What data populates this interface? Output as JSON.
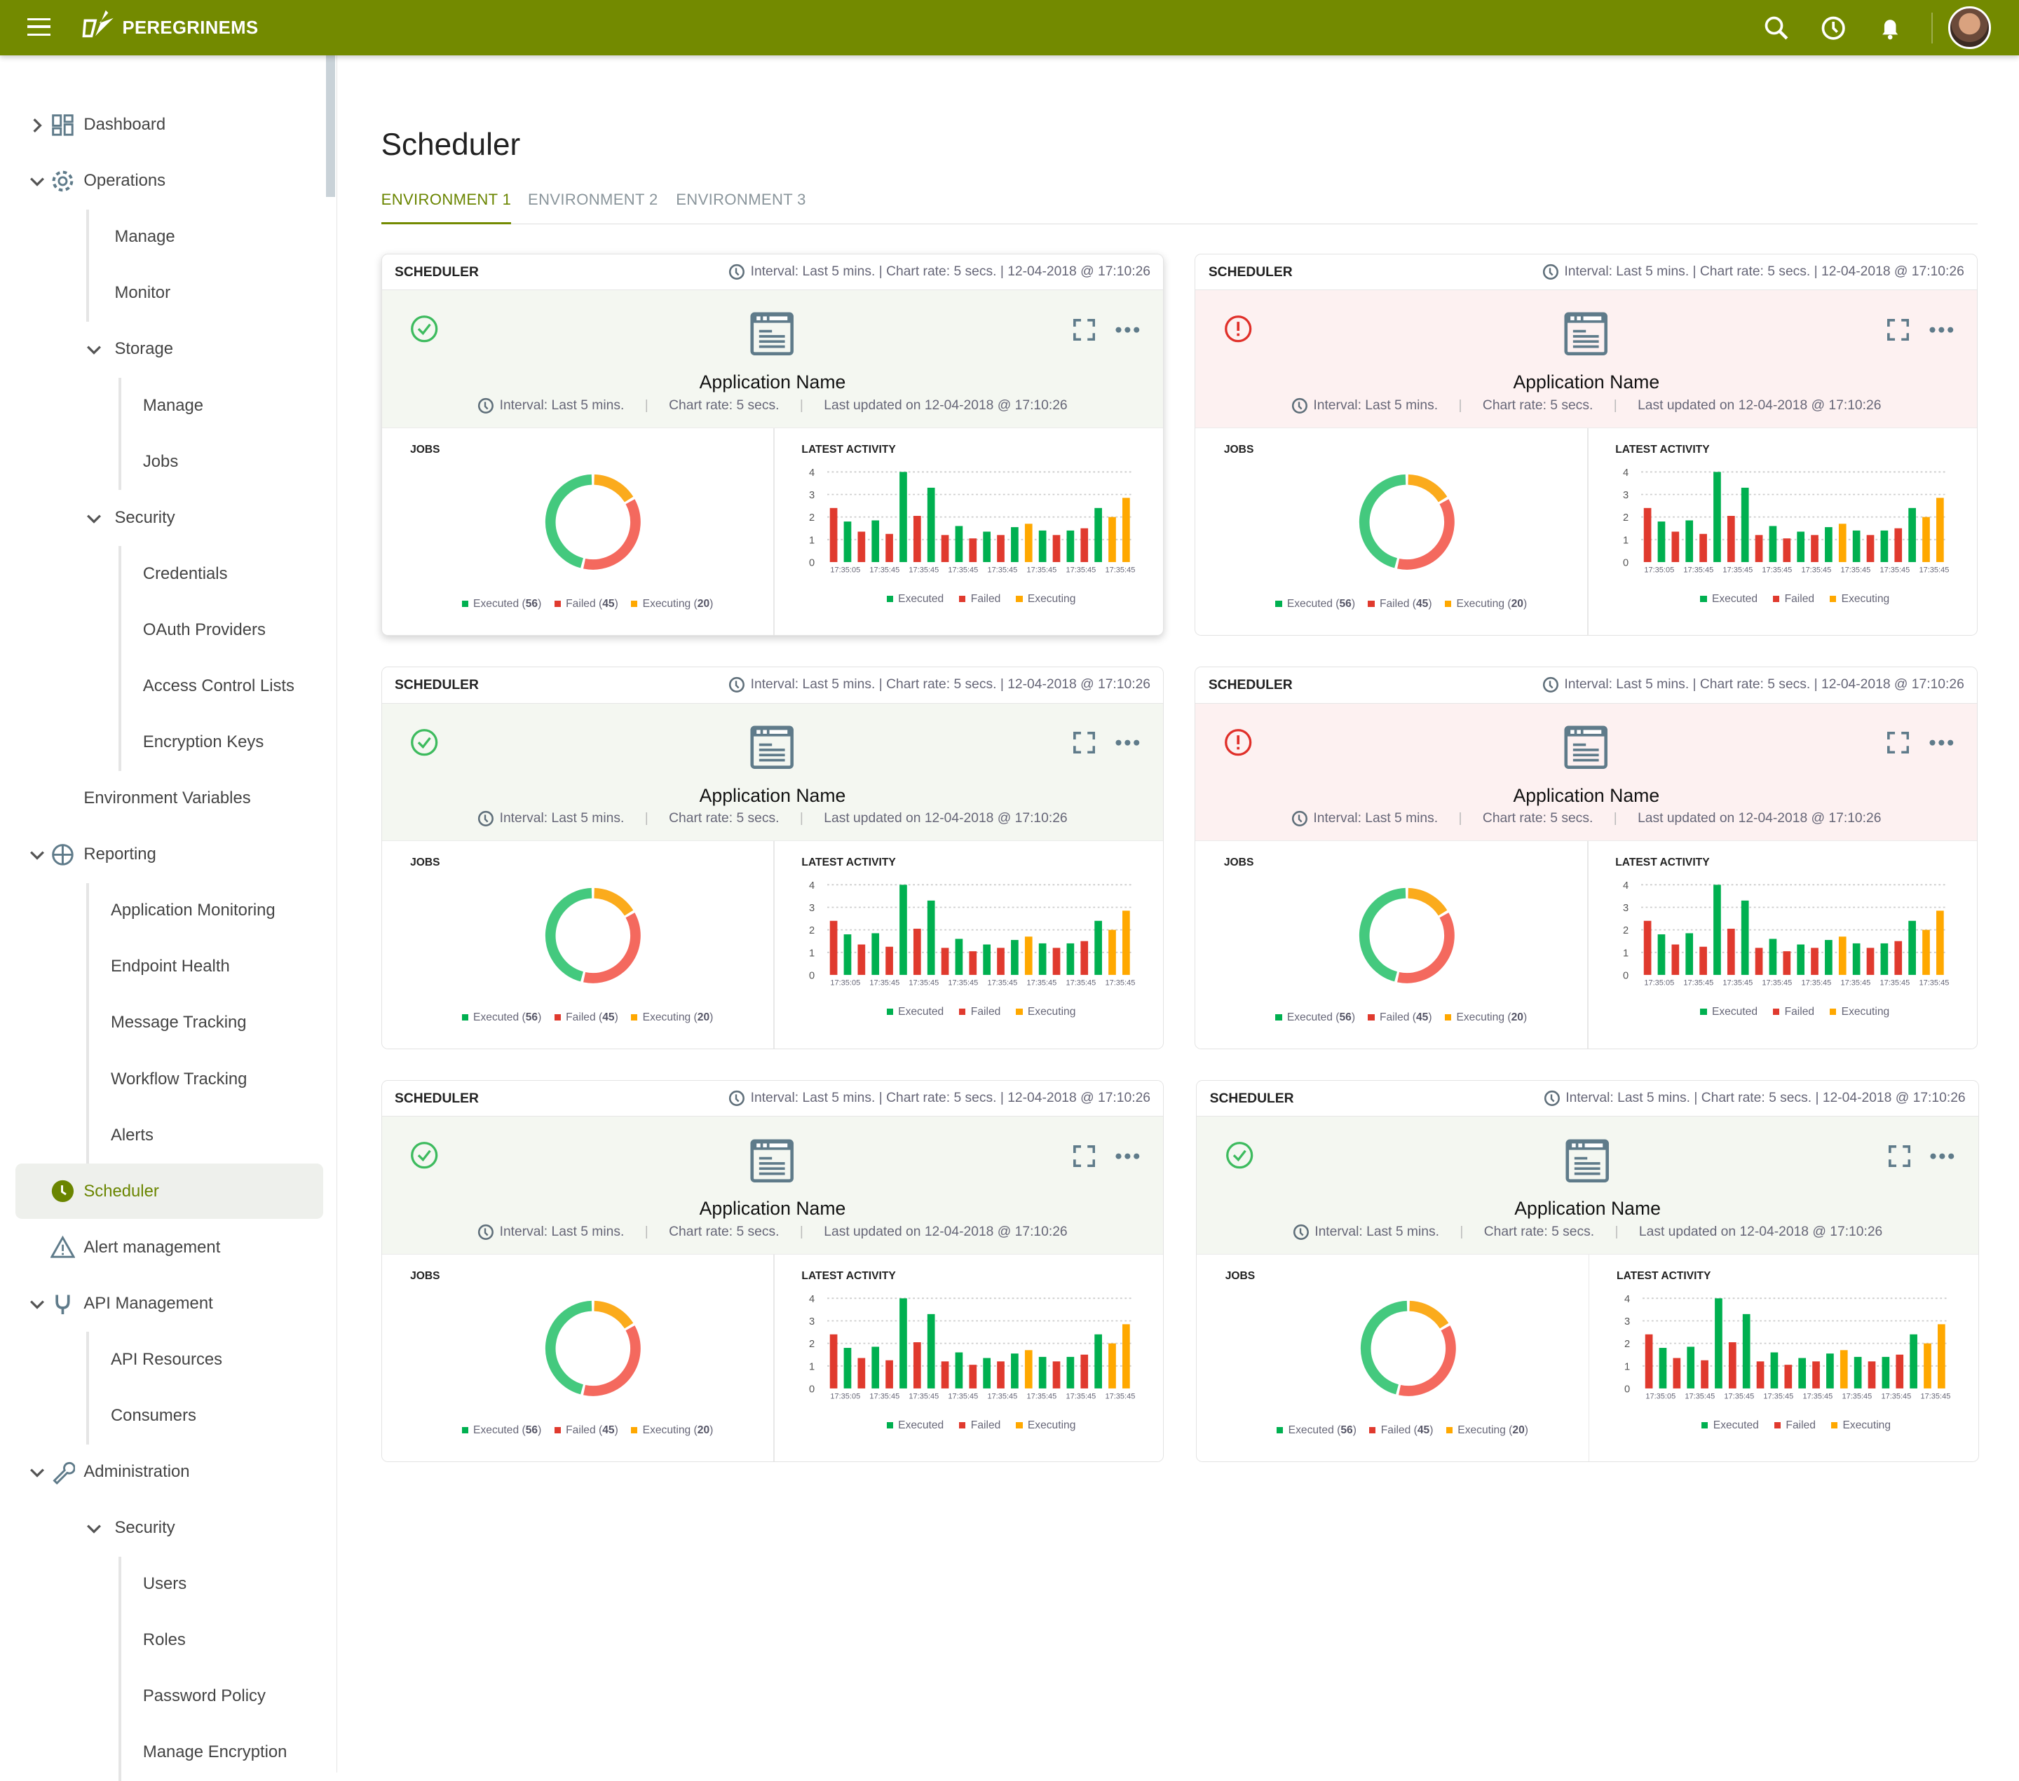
{
  "header": {
    "brand": "PEREGRINEMS",
    "icons": [
      "menu-icon",
      "search-icon",
      "history-icon",
      "bell-icon",
      "user-avatar"
    ],
    "color": "#738a00"
  },
  "sidebar": {
    "items": [
      {
        "label": "Dashboard",
        "level": 0,
        "chevron": "right",
        "icon": "dashboard-icon"
      },
      {
        "label": "Operations",
        "level": 0,
        "chevron": "down",
        "icon": "gear-icon"
      },
      {
        "label": "Manage",
        "level": 1
      },
      {
        "label": "Monitor",
        "level": 1
      },
      {
        "label": "Storage",
        "level": 1,
        "chevron": "down"
      },
      {
        "label": "Manage",
        "level": 2
      },
      {
        "label": "Jobs",
        "level": 2
      },
      {
        "label": "Security",
        "level": 1,
        "chevron": "down"
      },
      {
        "label": "Credentials",
        "level": 2
      },
      {
        "label": "OAuth Providers",
        "level": 2
      },
      {
        "label": "Access Control Lists",
        "level": 2
      },
      {
        "label": "Encryption Keys",
        "level": 2
      },
      {
        "label": "Environment Variables",
        "level": 0
      },
      {
        "label": "Reporting",
        "level": 0,
        "chevron": "down",
        "icon": "globe-icon"
      },
      {
        "label": "Application Monitoring",
        "level": 3
      },
      {
        "label": "Endpoint Health",
        "level": 3
      },
      {
        "label": "Message Tracking",
        "level": 3
      },
      {
        "label": "Workflow Tracking",
        "level": 3
      },
      {
        "label": "Alerts",
        "level": 3
      },
      {
        "label": "Scheduler",
        "level": 0,
        "icon": "clock-icon",
        "active": true
      },
      {
        "label": "Alert management",
        "level": 0,
        "icon": "warning-icon"
      },
      {
        "label": "API Management",
        "level": 0,
        "chevron": "down",
        "icon": "plug-icon"
      },
      {
        "label": "API Resources",
        "level": 3
      },
      {
        "label": "Consumers",
        "level": 3
      },
      {
        "label": "Administration",
        "level": 0,
        "chevron": "down",
        "icon": "wrench-icon"
      },
      {
        "label": "Security",
        "level": 1,
        "chevron": "down"
      },
      {
        "label": "Users",
        "level": 2
      },
      {
        "label": "Roles",
        "level": 2
      },
      {
        "label": "Password Policy",
        "level": 2
      },
      {
        "label": "Manage Encryption",
        "level": 2
      }
    ]
  },
  "page": {
    "title": "Scheduler",
    "tabs": [
      {
        "label": "ENVIRONMENT 1",
        "active": true
      },
      {
        "label": "ENVIRONMENT 2"
      },
      {
        "label": "ENVIRONMENT 3"
      }
    ]
  },
  "cards": [
    {
      "title": "SCHEDULER",
      "meta": "Interval: Last 5 mins. | Chart rate: 5 secs. | 12-04-2018 @ 17:10:26",
      "status": "ok",
      "app": "Application Name",
      "interval": "Interval: Last 5 mins.",
      "rate": "Chart rate: 5 secs.",
      "updated": "Last updated on 12-04-2018 @ 17:10:26",
      "jobs_label": "JOBS",
      "activity_label": "LATEST ACTIVITY"
    },
    {
      "title": "SCHEDULER",
      "meta": "Interval: Last 5 mins. | Chart rate: 5 secs. | 12-04-2018 @ 17:10:26",
      "status": "error",
      "app": "Application Name",
      "interval": "Interval: Last 5 mins.",
      "rate": "Chart rate: 5 secs.",
      "updated": "Last updated on 12-04-2018 @ 17:10:26",
      "jobs_label": "JOBS",
      "activity_label": "LATEST ACTIVITY"
    },
    {
      "title": "SCHEDULER",
      "meta": "Interval: Last 5 mins. | Chart rate: 5 secs. | 12-04-2018 @ 17:10:26",
      "status": "ok",
      "app": "Application Name",
      "interval": "Interval: Last 5 mins.",
      "rate": "Chart rate: 5 secs.",
      "updated": "Last updated on 12-04-2018 @ 17:10:26",
      "jobs_label": "JOBS",
      "activity_label": "LATEST ACTIVITY"
    },
    {
      "title": "SCHEDULER",
      "meta": "Interval: Last 5 mins. | Chart rate: 5 secs. | 12-04-2018 @ 17:10:26",
      "status": "error",
      "app": "Application Name",
      "interval": "Interval: Last 5 mins.",
      "rate": "Chart rate: 5 secs.",
      "updated": "Last updated on 12-04-2018 @ 17:10:26",
      "jobs_label": "JOBS",
      "activity_label": "LATEST ACTIVITY"
    },
    {
      "title": "SCHEDULER",
      "meta": "Interval: Last 5 mins. | Chart rate: 5 secs. | 12-04-2018 @ 17:10:26",
      "status": "ok",
      "app": "Application Name",
      "interval": "Interval: Last 5 mins.",
      "rate": "Chart rate: 5 secs.",
      "updated": "Last updated on 12-04-2018 @ 17:10:26",
      "jobs_label": "JOBS",
      "activity_label": "LATEST ACTIVITY"
    },
    {
      "title": "SCHEDULER",
      "meta": "Interval: Last 5 mins. | Chart rate: 5 secs. | 12-04-2018 @ 17:10:26",
      "status": "ok",
      "app": "Application Name",
      "interval": "Interval: Last 5 mins.",
      "rate": "Chart rate: 5 secs.",
      "updated": "Last updated on 12-04-2018 @ 17:10:26",
      "jobs_label": "JOBS",
      "activity_label": "LATEST ACTIVITY"
    }
  ],
  "colors": {
    "executed": "#00b050",
    "failed": "#e03a2e",
    "executing": "#ffa800",
    "donut_executed": "#44c97e",
    "donut_failed": "#f4695e",
    "donut_executing": "#fbab1c",
    "ok": "#3dbb5e",
    "error": "#e0302a"
  },
  "chart_data": [
    {
      "type": "pie",
      "variant": "donut",
      "labels": [
        "Executed",
        "Failed",
        "Executing"
      ],
      "values": [
        56,
        45,
        20
      ]
    },
    {
      "type": "bar",
      "ylim": [
        0,
        4
      ],
      "yticks": [
        0,
        1,
        2,
        3,
        4
      ],
      "grid": true,
      "legend": [
        "Executed",
        "Failed",
        "Executing"
      ],
      "legend_placement": "bottom",
      "xtick_labels": [
        "17:35:05",
        "17:35:45",
        "17:35:45",
        "17:35:45",
        "17:35:45",
        "17:35:45",
        "17:35:45",
        "17:35:45"
      ],
      "bars": [
        {
          "series": "Failed",
          "value": 2.4
        },
        {
          "series": "Executed",
          "value": 1.8
        },
        {
          "series": "Failed",
          "value": 1.35
        },
        {
          "series": "Executed",
          "value": 1.85
        },
        {
          "series": "Failed",
          "value": 1.25
        },
        {
          "series": "Executed",
          "value": 4.0
        },
        {
          "series": "Failed",
          "value": 2.05
        },
        {
          "series": "Executed",
          "value": 3.3
        },
        {
          "series": "Failed",
          "value": 1.2
        },
        {
          "series": "Executed",
          "value": 1.6
        },
        {
          "series": "Failed",
          "value": 1.05
        },
        {
          "series": "Executed",
          "value": 1.35
        },
        {
          "series": "Failed",
          "value": 1.2
        },
        {
          "series": "Executed",
          "value": 1.55
        },
        {
          "series": "Executing",
          "value": 1.7
        },
        {
          "series": "Executed",
          "value": 1.4
        },
        {
          "series": "Failed",
          "value": 1.2
        },
        {
          "series": "Executed",
          "value": 1.4
        },
        {
          "series": "Failed",
          "value": 1.5
        },
        {
          "series": "Executed",
          "value": 2.4
        },
        {
          "series": "Executing",
          "value": 2.0
        },
        {
          "series": "Executing",
          "value": 2.85
        }
      ]
    }
  ]
}
